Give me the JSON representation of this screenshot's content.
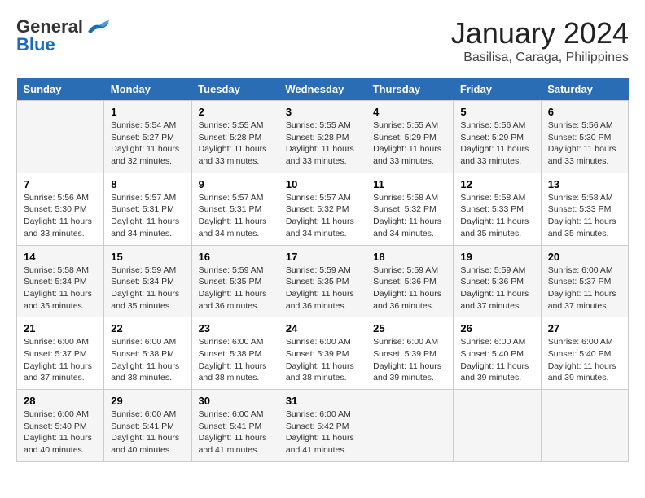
{
  "header": {
    "logo_line1": "General",
    "logo_line2": "Blue",
    "month": "January 2024",
    "location": "Basilisa, Caraga, Philippines"
  },
  "calendar": {
    "days_of_week": [
      "Sunday",
      "Monday",
      "Tuesday",
      "Wednesday",
      "Thursday",
      "Friday",
      "Saturday"
    ],
    "weeks": [
      [
        {
          "day": "",
          "detail": ""
        },
        {
          "day": "1",
          "detail": "Sunrise: 5:54 AM\nSunset: 5:27 PM\nDaylight: 11 hours\nand 32 minutes."
        },
        {
          "day": "2",
          "detail": "Sunrise: 5:55 AM\nSunset: 5:28 PM\nDaylight: 11 hours\nand 33 minutes."
        },
        {
          "day": "3",
          "detail": "Sunrise: 5:55 AM\nSunset: 5:28 PM\nDaylight: 11 hours\nand 33 minutes."
        },
        {
          "day": "4",
          "detail": "Sunrise: 5:55 AM\nSunset: 5:29 PM\nDaylight: 11 hours\nand 33 minutes."
        },
        {
          "day": "5",
          "detail": "Sunrise: 5:56 AM\nSunset: 5:29 PM\nDaylight: 11 hours\nand 33 minutes."
        },
        {
          "day": "6",
          "detail": "Sunrise: 5:56 AM\nSunset: 5:30 PM\nDaylight: 11 hours\nand 33 minutes."
        }
      ],
      [
        {
          "day": "7",
          "detail": "Sunrise: 5:56 AM\nSunset: 5:30 PM\nDaylight: 11 hours\nand 33 minutes."
        },
        {
          "day": "8",
          "detail": "Sunrise: 5:57 AM\nSunset: 5:31 PM\nDaylight: 11 hours\nand 34 minutes."
        },
        {
          "day": "9",
          "detail": "Sunrise: 5:57 AM\nSunset: 5:31 PM\nDaylight: 11 hours\nand 34 minutes."
        },
        {
          "day": "10",
          "detail": "Sunrise: 5:57 AM\nSunset: 5:32 PM\nDaylight: 11 hours\nand 34 minutes."
        },
        {
          "day": "11",
          "detail": "Sunrise: 5:58 AM\nSunset: 5:32 PM\nDaylight: 11 hours\nand 34 minutes."
        },
        {
          "day": "12",
          "detail": "Sunrise: 5:58 AM\nSunset: 5:33 PM\nDaylight: 11 hours\nand 35 minutes."
        },
        {
          "day": "13",
          "detail": "Sunrise: 5:58 AM\nSunset: 5:33 PM\nDaylight: 11 hours\nand 35 minutes."
        }
      ],
      [
        {
          "day": "14",
          "detail": "Sunrise: 5:58 AM\nSunset: 5:34 PM\nDaylight: 11 hours\nand 35 minutes."
        },
        {
          "day": "15",
          "detail": "Sunrise: 5:59 AM\nSunset: 5:34 PM\nDaylight: 11 hours\nand 35 minutes."
        },
        {
          "day": "16",
          "detail": "Sunrise: 5:59 AM\nSunset: 5:35 PM\nDaylight: 11 hours\nand 36 minutes."
        },
        {
          "day": "17",
          "detail": "Sunrise: 5:59 AM\nSunset: 5:35 PM\nDaylight: 11 hours\nand 36 minutes."
        },
        {
          "day": "18",
          "detail": "Sunrise: 5:59 AM\nSunset: 5:36 PM\nDaylight: 11 hours\nand 36 minutes."
        },
        {
          "day": "19",
          "detail": "Sunrise: 5:59 AM\nSunset: 5:36 PM\nDaylight: 11 hours\nand 37 minutes."
        },
        {
          "day": "20",
          "detail": "Sunrise: 6:00 AM\nSunset: 5:37 PM\nDaylight: 11 hours\nand 37 minutes."
        }
      ],
      [
        {
          "day": "21",
          "detail": "Sunrise: 6:00 AM\nSunset: 5:37 PM\nDaylight: 11 hours\nand 37 minutes."
        },
        {
          "day": "22",
          "detail": "Sunrise: 6:00 AM\nSunset: 5:38 PM\nDaylight: 11 hours\nand 38 minutes."
        },
        {
          "day": "23",
          "detail": "Sunrise: 6:00 AM\nSunset: 5:38 PM\nDaylight: 11 hours\nand 38 minutes."
        },
        {
          "day": "24",
          "detail": "Sunrise: 6:00 AM\nSunset: 5:39 PM\nDaylight: 11 hours\nand 38 minutes."
        },
        {
          "day": "25",
          "detail": "Sunrise: 6:00 AM\nSunset: 5:39 PM\nDaylight: 11 hours\nand 39 minutes."
        },
        {
          "day": "26",
          "detail": "Sunrise: 6:00 AM\nSunset: 5:40 PM\nDaylight: 11 hours\nand 39 minutes."
        },
        {
          "day": "27",
          "detail": "Sunrise: 6:00 AM\nSunset: 5:40 PM\nDaylight: 11 hours\nand 39 minutes."
        }
      ],
      [
        {
          "day": "28",
          "detail": "Sunrise: 6:00 AM\nSunset: 5:40 PM\nDaylight: 11 hours\nand 40 minutes."
        },
        {
          "day": "29",
          "detail": "Sunrise: 6:00 AM\nSunset: 5:41 PM\nDaylight: 11 hours\nand 40 minutes."
        },
        {
          "day": "30",
          "detail": "Sunrise: 6:00 AM\nSunset: 5:41 PM\nDaylight: 11 hours\nand 41 minutes."
        },
        {
          "day": "31",
          "detail": "Sunrise: 6:00 AM\nSunset: 5:42 PM\nDaylight: 11 hours\nand 41 minutes."
        },
        {
          "day": "",
          "detail": ""
        },
        {
          "day": "",
          "detail": ""
        },
        {
          "day": "",
          "detail": ""
        }
      ]
    ]
  }
}
